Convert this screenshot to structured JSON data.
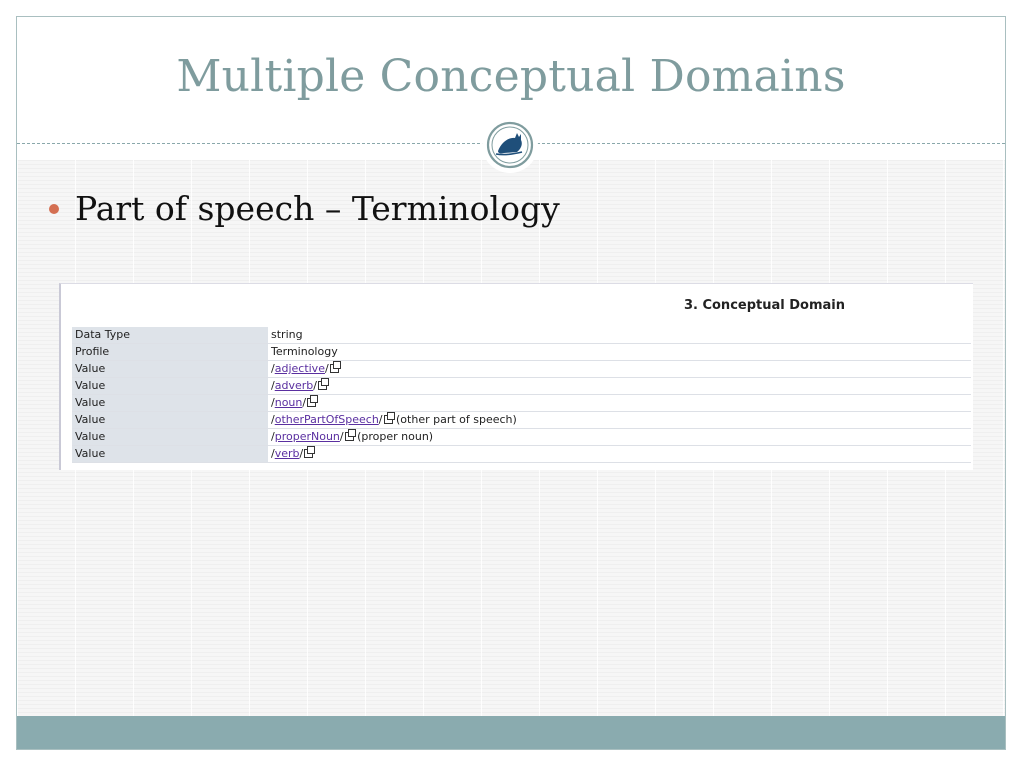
{
  "slide": {
    "title": "Multiple Conceptual Domains",
    "bullet": "Part of speech – Terminology",
    "colors": {
      "title": "#7f9c9e",
      "bullet": "#d46f52",
      "footer": "#8aabaf",
      "link": "#5a2fa0"
    },
    "emblem_icon": "cat-emblem-icon"
  },
  "panel": {
    "heading": "3. Conceptual Domain",
    "rows": [
      {
        "label": "Data Type",
        "value": "string"
      },
      {
        "label": "Profile",
        "value": "Terminology"
      },
      {
        "label": "Value",
        "prefix": "/",
        "link": "adjective",
        "suffix": "/",
        "note": ""
      },
      {
        "label": "Value",
        "prefix": "/",
        "link": "adverb",
        "suffix": "/",
        "note": ""
      },
      {
        "label": "Value",
        "prefix": "/",
        "link": "noun",
        "suffix": "/",
        "note": ""
      },
      {
        "label": "Value",
        "prefix": "/",
        "link": "otherPartOfSpeech",
        "suffix": "/",
        "note": "(other part of speech)"
      },
      {
        "label": "Value",
        "prefix": "/",
        "link": "properNoun",
        "suffix": "/",
        "note": "(proper noun)"
      },
      {
        "label": "Value",
        "prefix": "/",
        "link": "verb",
        "suffix": "/",
        "note": ""
      }
    ]
  }
}
